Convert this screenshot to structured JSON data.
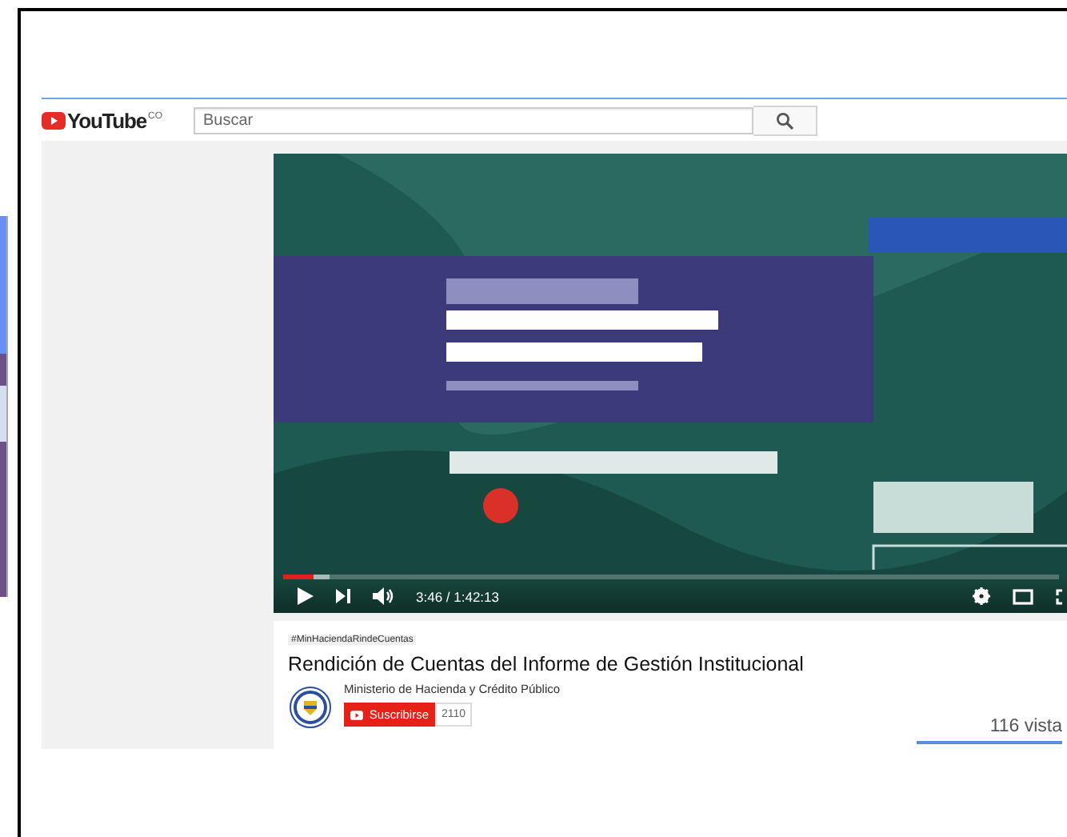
{
  "header": {
    "logo": "YouTube",
    "country": "CO",
    "search": {
      "placeholder": "Buscar"
    }
  },
  "player": {
    "progress": {
      "level": 0.04
    },
    "time": "3:46 / 1:42:13"
  },
  "video": {
    "hashtag": "#MinHaciendaRindeCuentas",
    "title": "Rendición de Cuentas del Informe de Gestión Institucional",
    "channel": "Ministerio de Hacienda y Crédito Público",
    "subscribe": "Suscribirse",
    "subscribers": "2110",
    "views": "116 vista",
    "like_bar": {
      "level": 1
    }
  }
}
